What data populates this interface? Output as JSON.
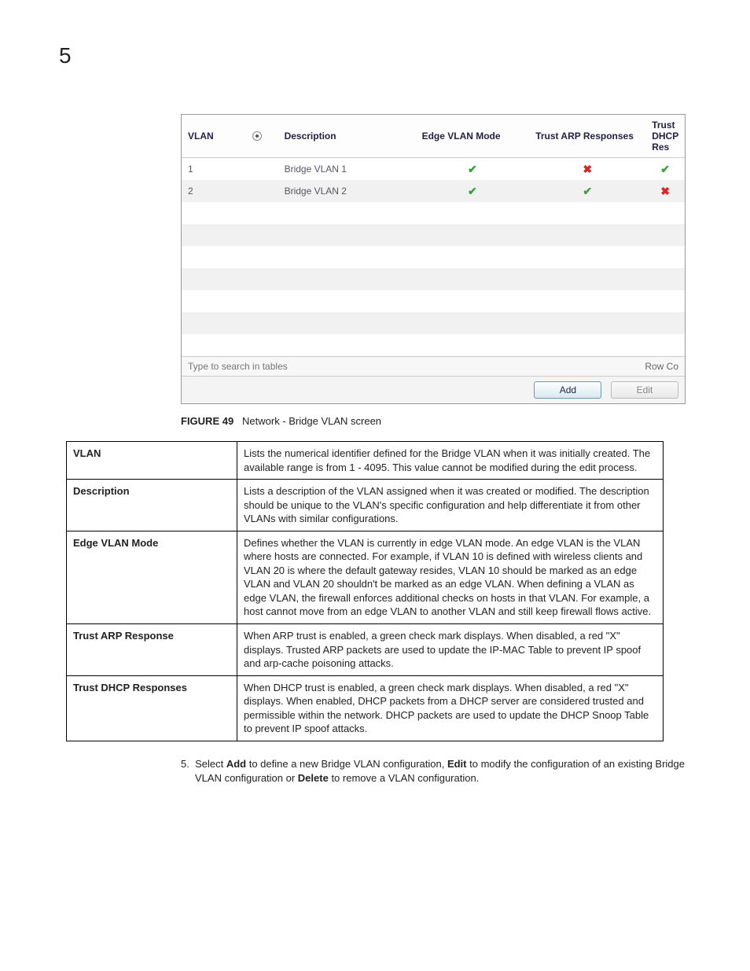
{
  "page_number": "5",
  "ui": {
    "headers": {
      "vlan": "VLAN",
      "description": "Description",
      "edge_mode": "Edge VLAN Mode",
      "trust_arp": "Trust ARP Responses",
      "trust_dhcp": "Trust DHCP Res"
    },
    "rows": [
      {
        "vlan": "1",
        "desc": "Bridge VLAN 1",
        "edge": true,
        "arp": false,
        "dhcp": true
      },
      {
        "vlan": "2",
        "desc": "Bridge VLAN 2",
        "edge": true,
        "arp": true,
        "dhcp": false
      }
    ],
    "search_placeholder": "Type to search in tables",
    "row_count_label": "Row Co",
    "buttons": {
      "add": "Add",
      "edit": "Edit"
    }
  },
  "figure": {
    "label": "FIGURE 49",
    "caption": "Network - Bridge VLAN screen"
  },
  "defs": [
    {
      "term": "VLAN",
      "desc": "Lists the numerical identifier defined for the Bridge VLAN when it was initially created. The available range is from 1 - 4095. This value cannot be modified during the edit process."
    },
    {
      "term": "Description",
      "desc": "Lists a description of the VLAN assigned when it was created or modified. The description should be unique to the VLAN's specific configuration and help differentiate it from other VLANs with similar configurations."
    },
    {
      "term": "Edge VLAN Mode",
      "desc": "Defines whether the VLAN is currently in edge VLAN mode. An edge VLAN is the VLAN where hosts are connected. For example, if VLAN 10 is defined with wireless clients and VLAN 20 is where the default gateway resides, VLAN 10 should be marked as an edge VLAN and VLAN 20 shouldn't be marked as an edge VLAN. When defining a VLAN as edge VLAN, the firewall enforces additional checks on hosts in that VLAN. For example, a host cannot move from an edge VLAN to another VLAN and still keep firewall flows active."
    },
    {
      "term": "Trust ARP Response",
      "desc": "When ARP trust is enabled, a green check mark displays. When disabled, a red \"X\" displays. Trusted ARP packets are used to update the IP-MAC Table to prevent IP spoof and arp-cache poisoning attacks."
    },
    {
      "term": "Trust DHCP Responses",
      "desc": "When DHCP trust is enabled, a green check mark displays. When disabled, a red \"X\" displays. When enabled, DHCP packets from a DHCP server are considered trusted and permissible within the network. DHCP packets are used to update the DHCP Snoop Table to prevent IP spoof attacks."
    }
  ],
  "instruction": {
    "step": "5.",
    "pre": "Select ",
    "b1": "Add",
    "mid1": " to define a new Bridge VLAN configuration, ",
    "b2": "Edit",
    "mid2": " to modify the configuration of an existing Bridge VLAN configuration or ",
    "b3": "Delete",
    "post": " to remove a VLAN configuration."
  }
}
